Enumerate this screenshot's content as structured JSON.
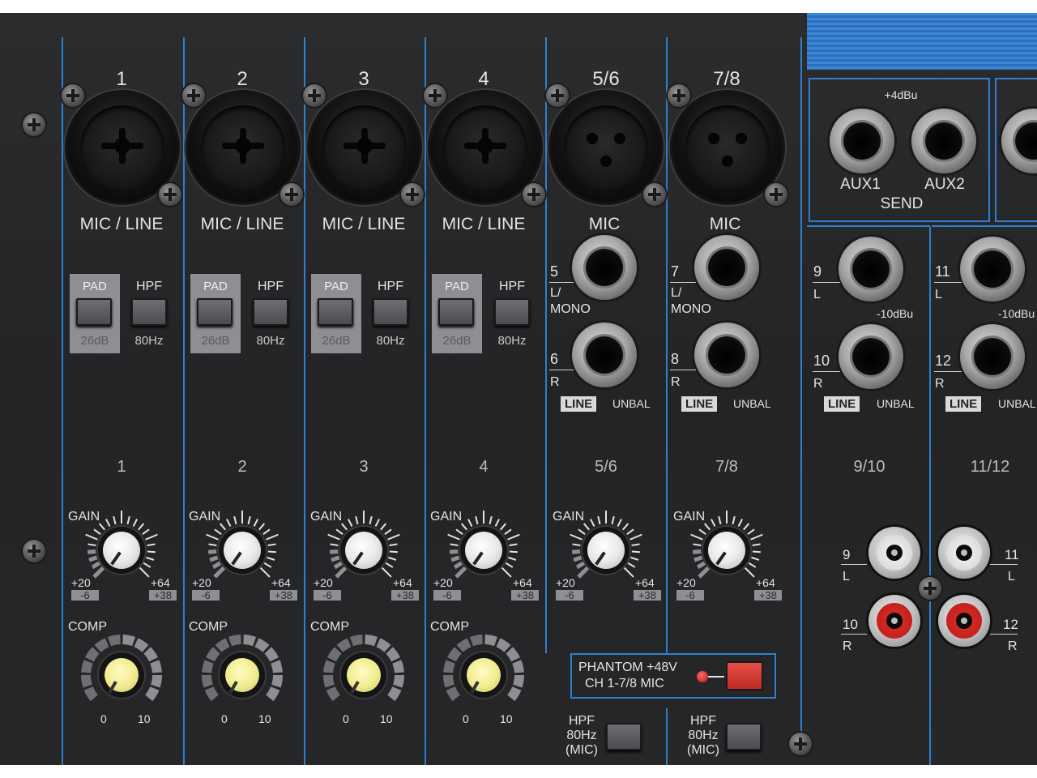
{
  "channels": {
    "numbers": [
      "1",
      "2",
      "3",
      "4",
      "5/6",
      "7/8"
    ],
    "mic_line_labels": [
      "MIC / LINE",
      "MIC / LINE",
      "MIC / LINE",
      "MIC / LINE"
    ],
    "mic_labels": [
      "MIC",
      "MIC"
    ],
    "pad_label": "PAD",
    "pad_value": "26dB",
    "hpf_label": "HPF",
    "hpf_value": "80Hz",
    "lower_numbers": [
      "1",
      "2",
      "3",
      "4",
      "5/6",
      "7/8",
      "9/10",
      "11/12"
    ],
    "gain_label": "GAIN",
    "gain_scale": {
      "left_top": "+20",
      "left_bottom": "-6",
      "right_top": "+64",
      "right_bottom": "+38"
    },
    "comp_label": "COMP",
    "comp_scale": {
      "min": "0",
      "max": "10"
    }
  },
  "stereo_inputs": {
    "ch56": {
      "left_num": "5",
      "left_sub": "L/",
      "left_sub2": "MONO",
      "right_num": "6",
      "right_sub": "R"
    },
    "ch78": {
      "left_num": "7",
      "left_sub": "L/",
      "left_sub2": "MONO",
      "right_num": "8",
      "right_sub": "R"
    },
    "ch910": {
      "left_num": "9",
      "left_sub": "L",
      "right_num": "10",
      "right_sub": "R",
      "level": "-10dBu"
    },
    "ch1112": {
      "left_num": "11",
      "left_sub": "L",
      "right_num": "12",
      "right_sub": "R",
      "level": "-10dBu"
    },
    "line_badge": "LINE",
    "unbal": "UNBAL"
  },
  "aux_send": {
    "level": "+4dBu",
    "aux1": "AUX1",
    "aux2": "AUX2",
    "send": "SEND"
  },
  "phantom": {
    "line1": "PHANTOM +48V",
    "line2": "CH 1-7/8 MIC"
  },
  "hpf_mic": {
    "line1": "HPF",
    "line2": "80Hz",
    "line3": "(MIC)"
  },
  "rca": {
    "left_top": "9",
    "left_top_sub": "L",
    "right_top": "11",
    "right_top_sub": "L",
    "left_bottom": "10",
    "left_bottom_sub": "R",
    "right_bottom": "12",
    "right_bottom_sub": "R"
  },
  "colors": {
    "accent_blue": "#2f7fd0",
    "panel": "#262729",
    "phantom_red": "#d8322c",
    "knob_yellow": "#f1eb8d"
  }
}
